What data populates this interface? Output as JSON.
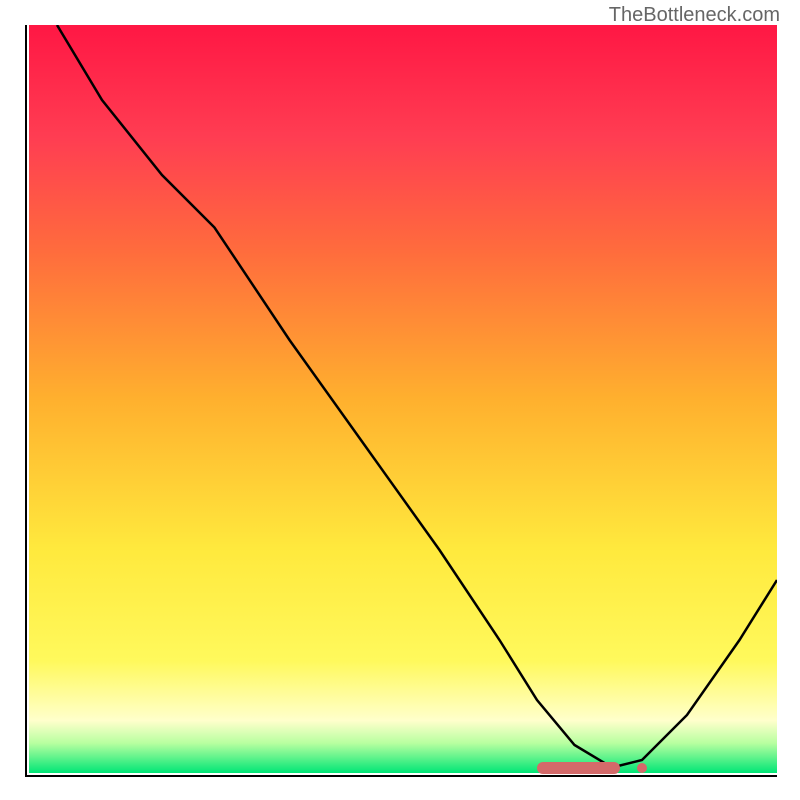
{
  "watermark": "TheBottleneck.com",
  "chart_data": {
    "type": "line",
    "title": "",
    "xlabel": "",
    "ylabel": "",
    "xlim": [
      0,
      100
    ],
    "ylim": [
      0,
      100
    ],
    "series": [
      {
        "name": "bottleneck-curve",
        "x": [
          4,
          10,
          18,
          25,
          35,
          45,
          55,
          63,
          68,
          73,
          78,
          82,
          88,
          95,
          100
        ],
        "y": [
          100,
          90,
          80,
          73,
          58,
          44,
          30,
          18,
          10,
          4,
          1,
          2,
          8,
          18,
          26
        ]
      }
    ],
    "optimal_marker": {
      "x_start": 68,
      "x_end": 79,
      "x_dot": 82,
      "y": 1
    },
    "gradient_stops": [
      {
        "offset": 0,
        "color": "#ff1744"
      },
      {
        "offset": 15,
        "color": "#ff3d52"
      },
      {
        "offset": 30,
        "color": "#ff6b3d"
      },
      {
        "offset": 50,
        "color": "#ffb02e"
      },
      {
        "offset": 70,
        "color": "#ffe93d"
      },
      {
        "offset": 85,
        "color": "#fff95c"
      },
      {
        "offset": 93,
        "color": "#ffffcc"
      },
      {
        "offset": 96,
        "color": "#b8ffa0"
      },
      {
        "offset": 100,
        "color": "#00e676"
      }
    ]
  }
}
